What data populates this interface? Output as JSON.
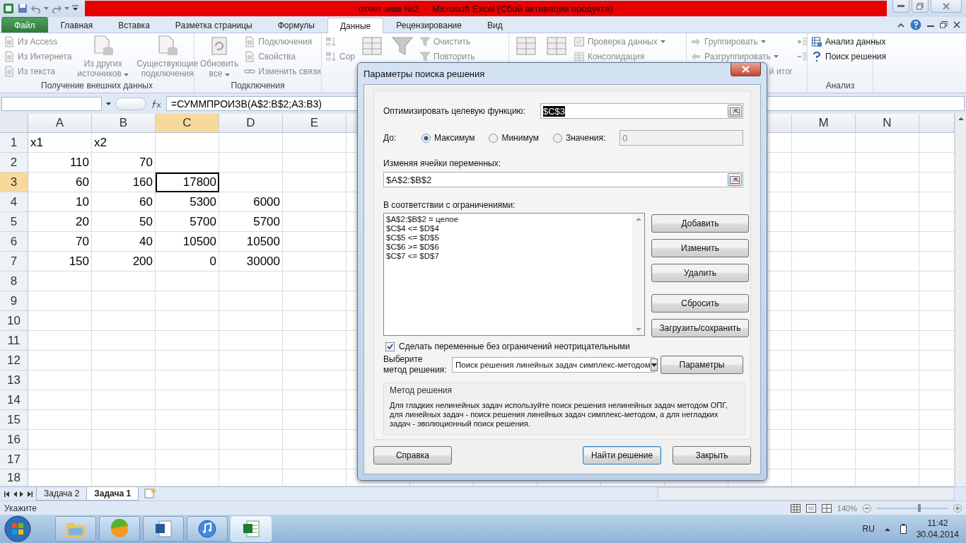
{
  "title_bar": {
    "title": "отчет эмм №2  -  Microsoft Excel (Сбой активации продукта)"
  },
  "ribbon_tabs": [
    {
      "label": "Файл",
      "kind": "file",
      "selected": false
    },
    {
      "label": "Главная",
      "kind": "tab",
      "selected": false
    },
    {
      "label": "Вставка",
      "kind": "tab",
      "selected": false
    },
    {
      "label": "Разметка страницы",
      "kind": "tab",
      "selected": false
    },
    {
      "label": "Формулы",
      "kind": "tab",
      "selected": false
    },
    {
      "label": "Данные",
      "kind": "tab",
      "selected": true
    },
    {
      "label": "Рецензирование",
      "kind": "tab",
      "selected": false
    },
    {
      "label": "Вид",
      "kind": "tab",
      "selected": false
    }
  ],
  "ribbon_groups": [
    {
      "label": "Получение внешних данных",
      "columns": [
        {
          "kind": "stack",
          "items": [
            {
              "label": "Из Access",
              "disabled": true
            },
            {
              "label": "Из Интернета",
              "disabled": true
            },
            {
              "label": "Из текста",
              "disabled": true
            }
          ]
        },
        {
          "kind": "large",
          "label": "Из других\nисточников",
          "dropdown": true,
          "disabled": true
        },
        {
          "kind": "large",
          "label": "Существующие\nподключения",
          "disabled": true
        }
      ]
    },
    {
      "label": "Подключения",
      "columns": [
        {
          "kind": "large",
          "label": "Обновить\nвсе",
          "dropdown": true,
          "disabled": true
        },
        {
          "kind": "stack",
          "items": [
            {
              "label": "Подключения",
              "disabled": true
            },
            {
              "label": "Свойства",
              "disabled": true
            },
            {
              "label": "Изменить связи",
              "disabled": true
            }
          ]
        }
      ]
    },
    {
      "columns": [
        {
          "kind": "stack",
          "items": [
            {
              "disabled": true
            },
            {
              "label": "Сор",
              "disabled": true
            }
          ]
        },
        {
          "kind": "large",
          "disabled": true
        },
        {
          "kind": "large",
          "disabled": true
        },
        {
          "kind": "stack",
          "items": [
            {
              "label": "Очистить",
              "disabled": true
            },
            {
              "label": "Повторить",
              "disabled": true
            }
          ]
        }
      ]
    },
    {
      "columns": [
        {
          "kind": "large",
          "disabled": true
        },
        {
          "kind": "large",
          "disabled": true
        },
        {
          "kind": "stack",
          "items": [
            {
              "label": "Проверка данных",
              "dropdown": true,
              "disabled": true
            },
            {
              "label": "Консолидация",
              "disabled": true
            }
          ]
        }
      ]
    },
    {
      "columns": [
        {
          "kind": "stack",
          "items": [
            {
              "label": "Группировать",
              "dropdown": true,
              "disabled": true
            },
            {
              "label": "Разгруппировать",
              "dropdown": true,
              "disabled": true
            },
            {
              "label": "й итог",
              "kind": "cut",
              "disabled": true
            }
          ]
        },
        {
          "kind": "stack",
          "items": [
            {
              "disabled": true
            },
            {
              "disabled": true
            }
          ]
        }
      ]
    },
    {
      "label": "Анализ",
      "columns": [
        {
          "kind": "stack",
          "items": [
            {
              "label": "Анализ данных",
              "disabled": false
            },
            {
              "label": "Поиск решения",
              "disabled": false
            }
          ]
        }
      ]
    }
  ],
  "formula_bar": {
    "formula": "=СУММПРОИЗВ(A$2:B$2;A3:B3)"
  },
  "sheet": {
    "columns": [
      {
        "label": "A",
        "selected": false
      },
      {
        "label": "B",
        "selected": false
      },
      {
        "label": "C",
        "selected": true
      },
      {
        "label": "D",
        "selected": false
      },
      {
        "label": "E",
        "selected": false
      },
      {
        "label": "M",
        "selected": false
      },
      {
        "label": "N",
        "selected": false
      }
    ],
    "rows": [
      {
        "number": "1",
        "selected": false,
        "cells": [
          {
            "text": "x1",
            "kind": "text",
            "selected": false
          },
          {
            "text": "x2",
            "kind": "text",
            "selected": false
          }
        ]
      },
      {
        "number": "2",
        "selected": false,
        "cells": [
          {
            "text": "110",
            "kind": "number",
            "selected": false
          },
          {
            "text": "70",
            "kind": "number",
            "selected": false
          }
        ]
      },
      {
        "number": "3",
        "selected": true,
        "cells": [
          {
            "text": "60",
            "kind": "number",
            "selected": false
          },
          {
            "text": "160",
            "kind": "number",
            "selected": false
          },
          {
            "text": "17800",
            "kind": "number",
            "selected": true
          }
        ]
      },
      {
        "number": "4",
        "selected": false,
        "cells": [
          {
            "text": "10",
            "kind": "number",
            "selected": false
          },
          {
            "text": "60",
            "kind": "number",
            "selected": false
          },
          {
            "text": "5300",
            "kind": "number",
            "selected": false
          },
          {
            "text": "6000",
            "kind": "number",
            "selected": false
          }
        ]
      },
      {
        "number": "5",
        "selected": false,
        "cells": [
          {
            "text": "20",
            "kind": "number",
            "selected": false
          },
          {
            "text": "50",
            "kind": "number",
            "selected": false
          },
          {
            "text": "5700",
            "kind": "number",
            "selected": false
          },
          {
            "text": "5700",
            "kind": "number",
            "selected": false
          }
        ]
      },
      {
        "number": "6",
        "selected": false,
        "cells": [
          {
            "text": "70",
            "kind": "number",
            "selected": false
          },
          {
            "text": "40",
            "kind": "number",
            "selected": false
          },
          {
            "text": "10500",
            "kind": "number",
            "selected": false
          },
          {
            "text": "10500",
            "kind": "number",
            "selected": false
          }
        ]
      },
      {
        "number": "7",
        "selected": false,
        "cells": [
          {
            "text": "150",
            "kind": "number",
            "selected": false
          },
          {
            "text": "200",
            "kind": "number",
            "selected": false
          },
          {
            "text": "0",
            "kind": "number",
            "selected": false
          },
          {
            "text": "30000",
            "kind": "number",
            "selected": false
          }
        ]
      },
      {
        "number": "8",
        "selected": false
      },
      {
        "number": "9",
        "selected": false
      },
      {
        "number": "10",
        "selected": false
      },
      {
        "number": "11",
        "selected": false
      },
      {
        "number": "12",
        "selected": false
      },
      {
        "number": "13",
        "selected": false
      },
      {
        "number": "14",
        "selected": false
      },
      {
        "number": "15",
        "selected": false
      },
      {
        "number": "16",
        "selected": false
      },
      {
        "number": "17",
        "selected": false
      },
      {
        "number": "18",
        "selected": false
      }
    ]
  },
  "sheet_tabs": [
    {
      "label": "Задача 2",
      "selected": false
    },
    {
      "label": "Задача 1",
      "selected": true
    }
  ],
  "status_bar": {
    "mode": "Укажите",
    "zoom": "140%",
    "zoom_slider": {
      "level": 0.6
    }
  },
  "taskbar": {
    "apps": [
      {
        "selected": false
      },
      {
        "selected": false
      },
      {
        "selected": false
      },
      {
        "selected": false
      },
      {
        "selected": true
      }
    ],
    "language": "RU",
    "time": "11:42",
    "date": "30.04.2014"
  },
  "dialog": {
    "title": "Параметры поиска решения",
    "objective": {
      "label": "Оптимизировать целевую функцию:",
      "value": "$C$3",
      "value_selected": true
    },
    "to": {
      "label": "До:",
      "options": [
        {
          "label": "Максимум",
          "selected": true
        },
        {
          "label": "Минимум",
          "selected": false
        },
        {
          "label": "Значения:",
          "selected": false
        }
      ],
      "value": "0",
      "value_disabled": true
    },
    "variables": {
      "label": "Изменяя ячейки переменных:",
      "value": "$A$2:$B$2"
    },
    "constraints": {
      "label": "В соответствии с ограничениями:",
      "items": [
        "$A$2:$B$2 = целое",
        "$C$4 <= $D$4",
        "$C$5 <= $D$5",
        "$C$6 >= $D$6",
        "$C$7 <= $D$7"
      ]
    },
    "constraint_buttons": [
      "Добавить",
      "Изменить",
      "Удалить",
      "Сбросить",
      "Загрузить/сохранить"
    ],
    "nonnegative": {
      "label": "Сделать переменные без ограничений неотрицательными",
      "checked": true
    },
    "method": {
      "label": "Выберите\nметод решения:",
      "value": "Поиск решения линейных задач симплекс-методом"
    },
    "parameters_button": "Параметры",
    "method_info": {
      "title": "Метод решения",
      "text": "Для гладких нелинейных задач используйте поиск решения нелинейных задач методом ОПГ, для линейных задач - поиск решения линейных задач симплекс-методом, а для негладких задач - эволюционный поиск решения."
    },
    "footer_buttons": [
      {
        "label": "Справка",
        "kind": "normal"
      },
      {
        "label": "Найти решение",
        "kind": "default"
      },
      {
        "label": "Закрыть",
        "kind": "normal"
      }
    ]
  }
}
